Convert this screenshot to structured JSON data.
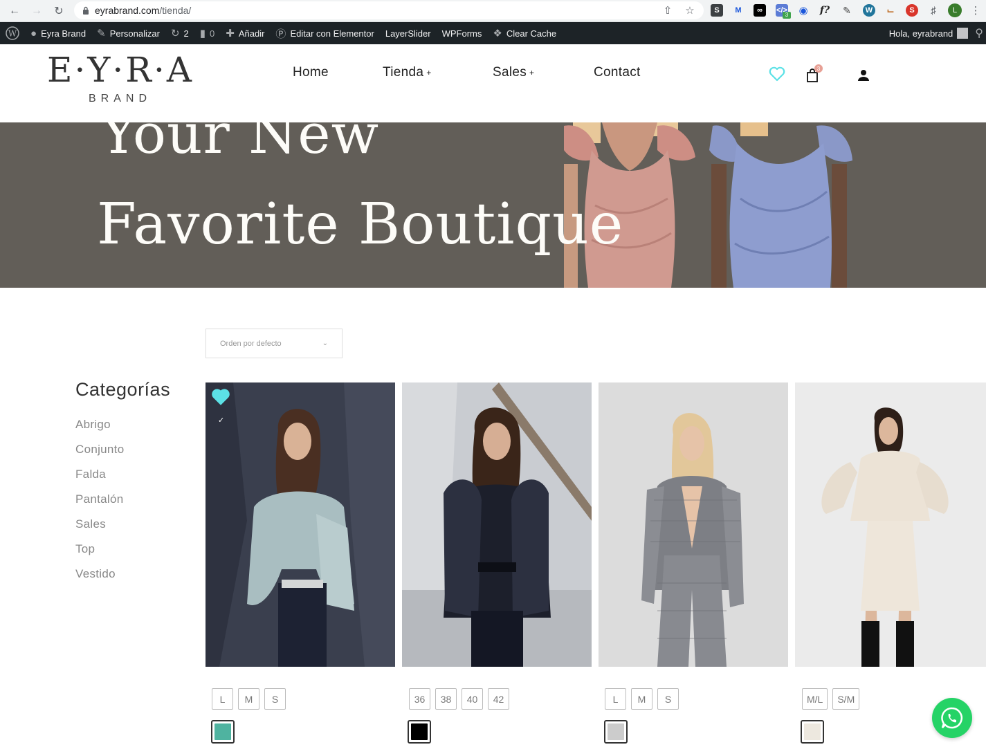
{
  "browser": {
    "url_host": "eyrabrand.com",
    "url_path": "/tienda/",
    "profile_initial": "L",
    "extension_badge": "3"
  },
  "wp_admin": {
    "site_name": "Eyra Brand",
    "customize": "Personalizar",
    "updates_count": "2",
    "comments_count": "0",
    "add_new": "Añadir",
    "elementor": "Editar con Elementor",
    "layerslider": "LayerSlider",
    "wpforms": "WPForms",
    "clear_cache": "Clear Cache",
    "greeting": "Hola, eyrabrand"
  },
  "header": {
    "logo_main": "E·Y·R·A",
    "logo_sub": "BRAND",
    "nav": [
      {
        "label": "Home",
        "has_submenu": false
      },
      {
        "label": "Tienda",
        "has_submenu": true
      },
      {
        "label": "Sales",
        "has_submenu": true
      },
      {
        "label": "Contact",
        "has_submenu": false
      }
    ],
    "submenu_marker": "+",
    "cart_count": "3",
    "accent": "#5ce1e6"
  },
  "hero": {
    "line1": "Your New",
    "line2": "Favorite Boutique",
    "bg_color": "#625e58"
  },
  "shop": {
    "sort_selected": "Orden por defecto"
  },
  "sidebar": {
    "title": "Categorías",
    "categories": [
      "Abrigo",
      "Conjunto",
      "Falda",
      "Pantalón",
      "Sales",
      "Top",
      "Vestido"
    ]
  },
  "products": [
    {
      "sizes": [
        "L",
        "M",
        "S"
      ],
      "swatch": "#4fb3a0",
      "wishlisted": true,
      "wish_check": "✓"
    },
    {
      "sizes": [
        "36",
        "38",
        "40",
        "42"
      ],
      "swatch": "#000000",
      "wishlisted": false
    },
    {
      "sizes": [
        "L",
        "M",
        "S"
      ],
      "swatch": "#cccccc",
      "wishlisted": false
    },
    {
      "sizes": [
        "M/L",
        "S/M"
      ],
      "swatch": "#ede8df",
      "wishlisted": false
    }
  ]
}
